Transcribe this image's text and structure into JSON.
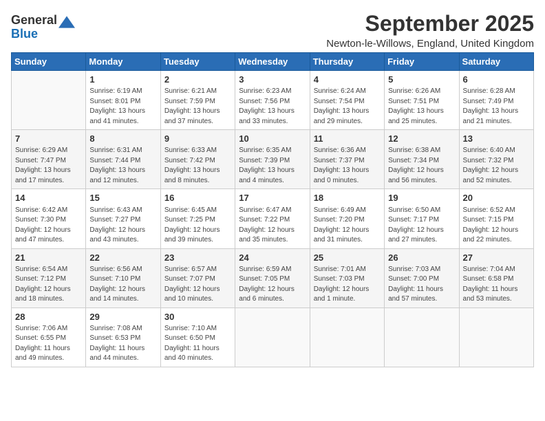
{
  "logo": {
    "general": "General",
    "blue": "Blue"
  },
  "title": "September 2025",
  "location": "Newton-le-Willows, England, United Kingdom",
  "headers": [
    "Sunday",
    "Monday",
    "Tuesday",
    "Wednesday",
    "Thursday",
    "Friday",
    "Saturday"
  ],
  "weeks": [
    [
      {
        "day": "",
        "info": ""
      },
      {
        "day": "1",
        "info": "Sunrise: 6:19 AM\nSunset: 8:01 PM\nDaylight: 13 hours\nand 41 minutes."
      },
      {
        "day": "2",
        "info": "Sunrise: 6:21 AM\nSunset: 7:59 PM\nDaylight: 13 hours\nand 37 minutes."
      },
      {
        "day": "3",
        "info": "Sunrise: 6:23 AM\nSunset: 7:56 PM\nDaylight: 13 hours\nand 33 minutes."
      },
      {
        "day": "4",
        "info": "Sunrise: 6:24 AM\nSunset: 7:54 PM\nDaylight: 13 hours\nand 29 minutes."
      },
      {
        "day": "5",
        "info": "Sunrise: 6:26 AM\nSunset: 7:51 PM\nDaylight: 13 hours\nand 25 minutes."
      },
      {
        "day": "6",
        "info": "Sunrise: 6:28 AM\nSunset: 7:49 PM\nDaylight: 13 hours\nand 21 minutes."
      }
    ],
    [
      {
        "day": "7",
        "info": "Sunrise: 6:29 AM\nSunset: 7:47 PM\nDaylight: 13 hours\nand 17 minutes."
      },
      {
        "day": "8",
        "info": "Sunrise: 6:31 AM\nSunset: 7:44 PM\nDaylight: 13 hours\nand 12 minutes."
      },
      {
        "day": "9",
        "info": "Sunrise: 6:33 AM\nSunset: 7:42 PM\nDaylight: 13 hours\nand 8 minutes."
      },
      {
        "day": "10",
        "info": "Sunrise: 6:35 AM\nSunset: 7:39 PM\nDaylight: 13 hours\nand 4 minutes."
      },
      {
        "day": "11",
        "info": "Sunrise: 6:36 AM\nSunset: 7:37 PM\nDaylight: 13 hours\nand 0 minutes."
      },
      {
        "day": "12",
        "info": "Sunrise: 6:38 AM\nSunset: 7:34 PM\nDaylight: 12 hours\nand 56 minutes."
      },
      {
        "day": "13",
        "info": "Sunrise: 6:40 AM\nSunset: 7:32 PM\nDaylight: 12 hours\nand 52 minutes."
      }
    ],
    [
      {
        "day": "14",
        "info": "Sunrise: 6:42 AM\nSunset: 7:30 PM\nDaylight: 12 hours\nand 47 minutes."
      },
      {
        "day": "15",
        "info": "Sunrise: 6:43 AM\nSunset: 7:27 PM\nDaylight: 12 hours\nand 43 minutes."
      },
      {
        "day": "16",
        "info": "Sunrise: 6:45 AM\nSunset: 7:25 PM\nDaylight: 12 hours\nand 39 minutes."
      },
      {
        "day": "17",
        "info": "Sunrise: 6:47 AM\nSunset: 7:22 PM\nDaylight: 12 hours\nand 35 minutes."
      },
      {
        "day": "18",
        "info": "Sunrise: 6:49 AM\nSunset: 7:20 PM\nDaylight: 12 hours\nand 31 minutes."
      },
      {
        "day": "19",
        "info": "Sunrise: 6:50 AM\nSunset: 7:17 PM\nDaylight: 12 hours\nand 27 minutes."
      },
      {
        "day": "20",
        "info": "Sunrise: 6:52 AM\nSunset: 7:15 PM\nDaylight: 12 hours\nand 22 minutes."
      }
    ],
    [
      {
        "day": "21",
        "info": "Sunrise: 6:54 AM\nSunset: 7:12 PM\nDaylight: 12 hours\nand 18 minutes."
      },
      {
        "day": "22",
        "info": "Sunrise: 6:56 AM\nSunset: 7:10 PM\nDaylight: 12 hours\nand 14 minutes."
      },
      {
        "day": "23",
        "info": "Sunrise: 6:57 AM\nSunset: 7:07 PM\nDaylight: 12 hours\nand 10 minutes."
      },
      {
        "day": "24",
        "info": "Sunrise: 6:59 AM\nSunset: 7:05 PM\nDaylight: 12 hours\nand 6 minutes."
      },
      {
        "day": "25",
        "info": "Sunrise: 7:01 AM\nSunset: 7:03 PM\nDaylight: 12 hours\nand 1 minute."
      },
      {
        "day": "26",
        "info": "Sunrise: 7:03 AM\nSunset: 7:00 PM\nDaylight: 11 hours\nand 57 minutes."
      },
      {
        "day": "27",
        "info": "Sunrise: 7:04 AM\nSunset: 6:58 PM\nDaylight: 11 hours\nand 53 minutes."
      }
    ],
    [
      {
        "day": "28",
        "info": "Sunrise: 7:06 AM\nSunset: 6:55 PM\nDaylight: 11 hours\nand 49 minutes."
      },
      {
        "day": "29",
        "info": "Sunrise: 7:08 AM\nSunset: 6:53 PM\nDaylight: 11 hours\nand 44 minutes."
      },
      {
        "day": "30",
        "info": "Sunrise: 7:10 AM\nSunset: 6:50 PM\nDaylight: 11 hours\nand 40 minutes."
      },
      {
        "day": "",
        "info": ""
      },
      {
        "day": "",
        "info": ""
      },
      {
        "day": "",
        "info": ""
      },
      {
        "day": "",
        "info": ""
      }
    ]
  ]
}
